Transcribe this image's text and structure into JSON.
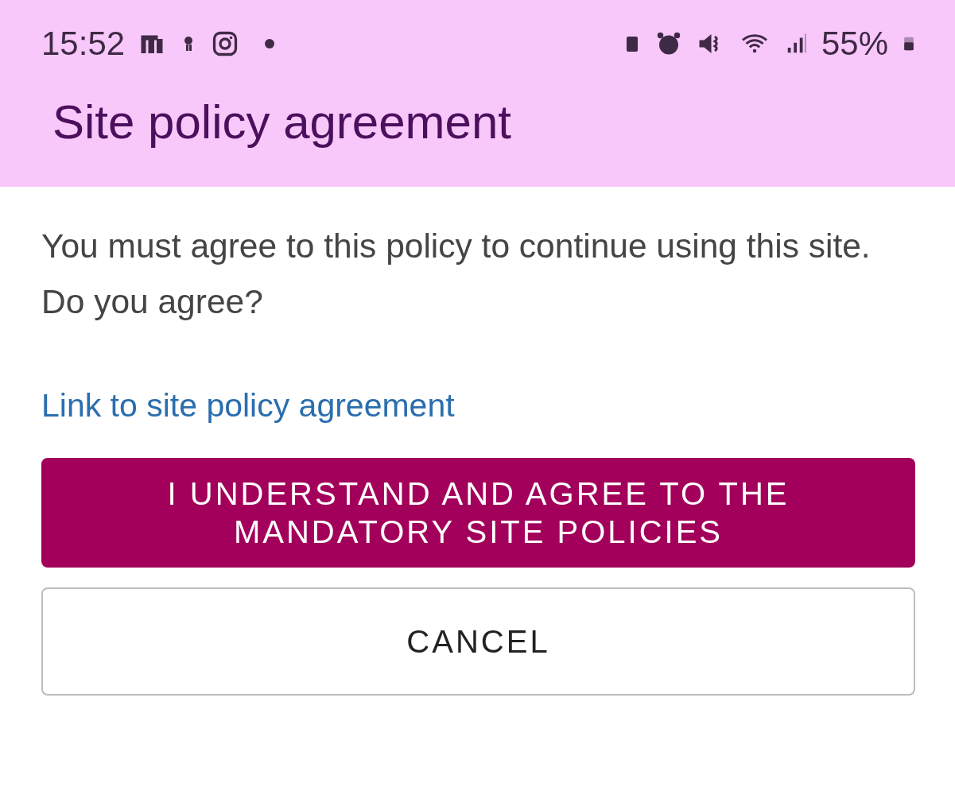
{
  "status_bar": {
    "time": "15:52",
    "battery": "55%"
  },
  "app_bar": {
    "title": "Site policy agreement"
  },
  "dialog": {
    "message": "You must agree to this policy to continue using this site. Do you agree?",
    "link": "Link to site policy agreement",
    "buttons": [
      {
        "kind": "primary",
        "label": "I UNDERSTAND AND AGREE TO THE MANDATORY SITE POLICIES"
      },
      {
        "kind": "outlined",
        "label": "CANCEL"
      }
    ]
  }
}
